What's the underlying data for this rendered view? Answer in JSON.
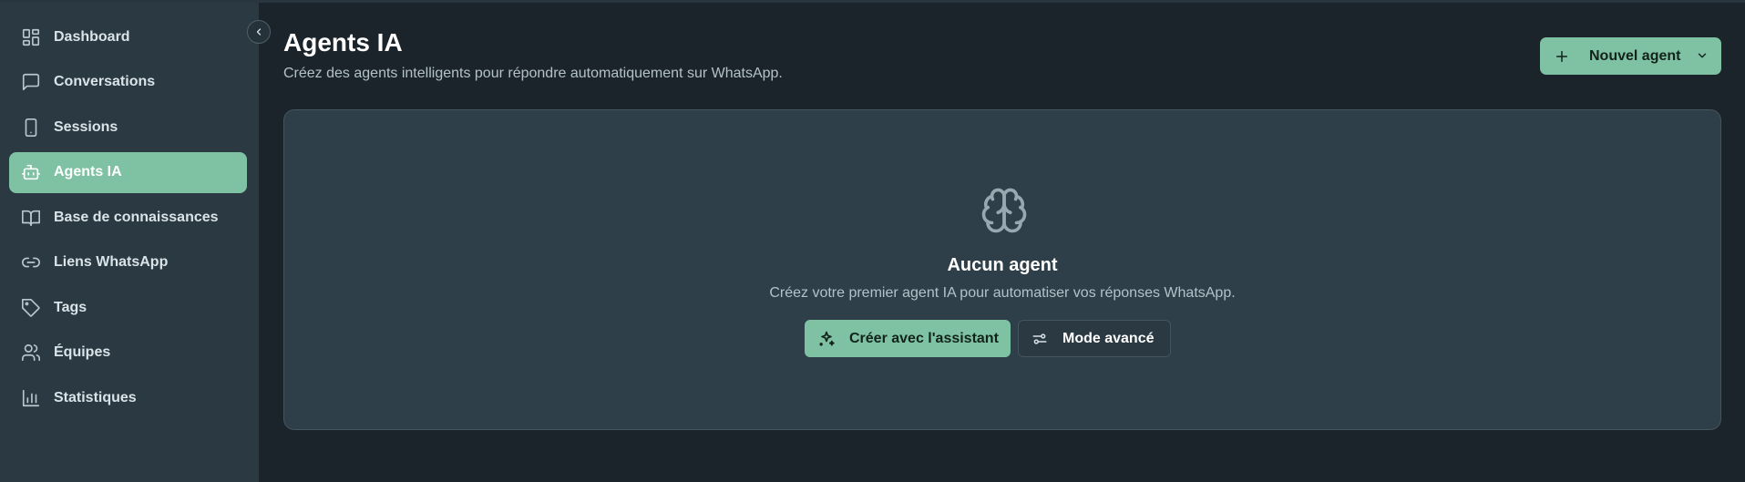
{
  "sidebar": {
    "items": [
      {
        "label": "Dashboard",
        "icon": "layout-grid-icon",
        "active": false
      },
      {
        "label": "Conversations",
        "icon": "message-square-icon",
        "active": false
      },
      {
        "label": "Sessions",
        "icon": "smartphone-icon",
        "active": false
      },
      {
        "label": "Agents IA",
        "icon": "bot-icon",
        "active": true
      },
      {
        "label": "Base de connaissances",
        "icon": "book-open-icon",
        "active": false
      },
      {
        "label": "Liens WhatsApp",
        "icon": "link-icon",
        "active": false
      },
      {
        "label": "Tags",
        "icon": "tag-icon",
        "active": false
      },
      {
        "label": "Équipes",
        "icon": "users-icon",
        "active": false
      },
      {
        "label": "Statistiques",
        "icon": "bar-chart-icon",
        "active": false
      }
    ],
    "collapse_icon": "chevron-left-icon"
  },
  "header": {
    "title": "Agents IA",
    "subtitle": "Créez des agents intelligents pour répondre automatiquement sur WhatsApp.",
    "new_agent_label": "Nouvel agent"
  },
  "empty_state": {
    "icon": "brain-icon",
    "title": "Aucun agent",
    "description": "Créez votre premier agent IA pour automatiser vos réponses WhatsApp.",
    "assistant_button_label": "Créer avec l'assistant",
    "advanced_button_label": "Mode avancé"
  },
  "colors": {
    "accent": "#7ec2a3",
    "background": "#1b242b",
    "sidebar": "#2a3942",
    "card": "#2f3f49"
  }
}
